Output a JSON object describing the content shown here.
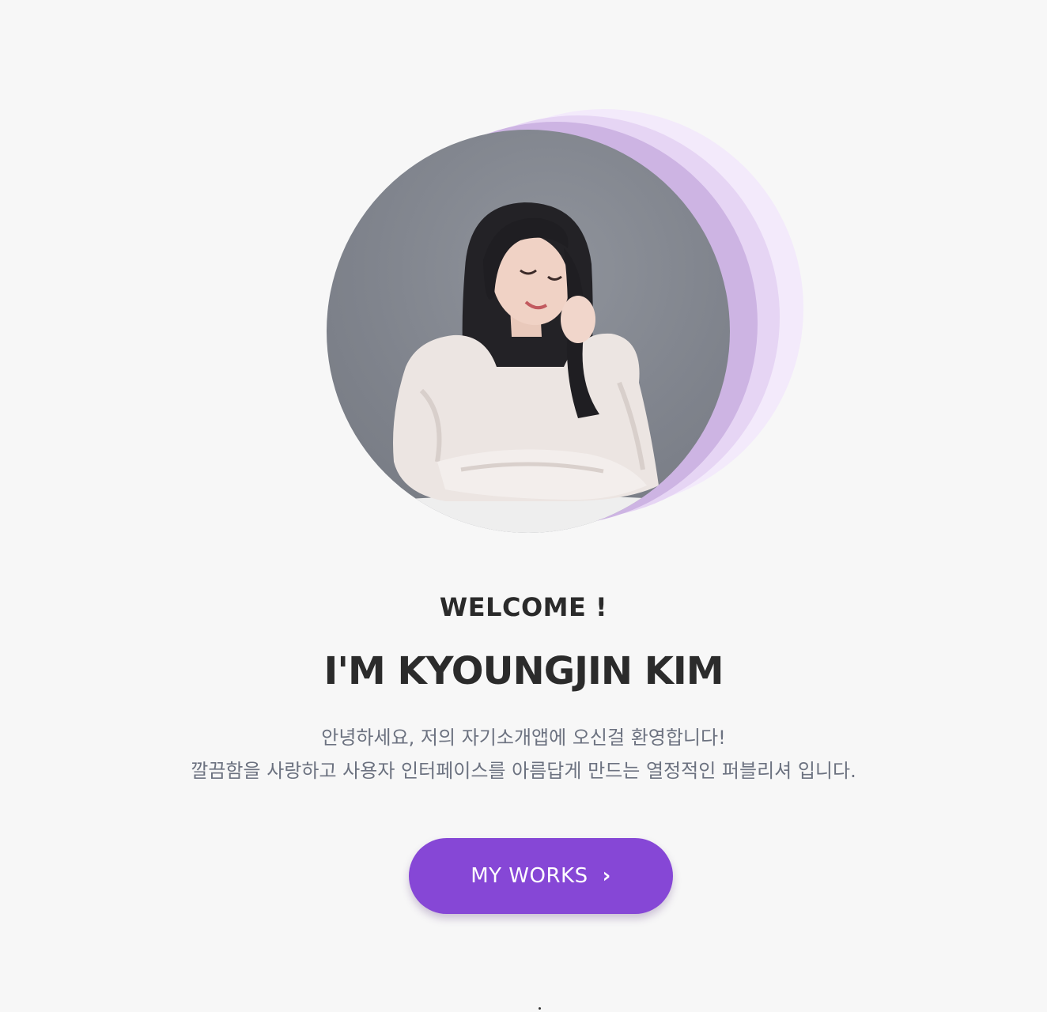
{
  "hero": {
    "welcome": "WELCOME !",
    "name": "I'M KYOUNGJIN KIM",
    "intro_line1": "안녕하세요, 저의 자기소개앱에 오신걸 환영합니다!",
    "intro_line2": "깔끔함을 사랑하고 사용자 인터페이스를 아름답게 만드는 열정적인 퍼블리셔 입니다."
  },
  "cta": {
    "label": "MY WORKS",
    "icon": "chevron-right-icon",
    "icon_glyph": "›"
  },
  "colors": {
    "accent": "#8647d6",
    "ring_dark": "#cdb4e3",
    "ring_mid": "#e6d5f4",
    "ring_light": "#f3eafb",
    "background": "#f7f7f7"
  }
}
